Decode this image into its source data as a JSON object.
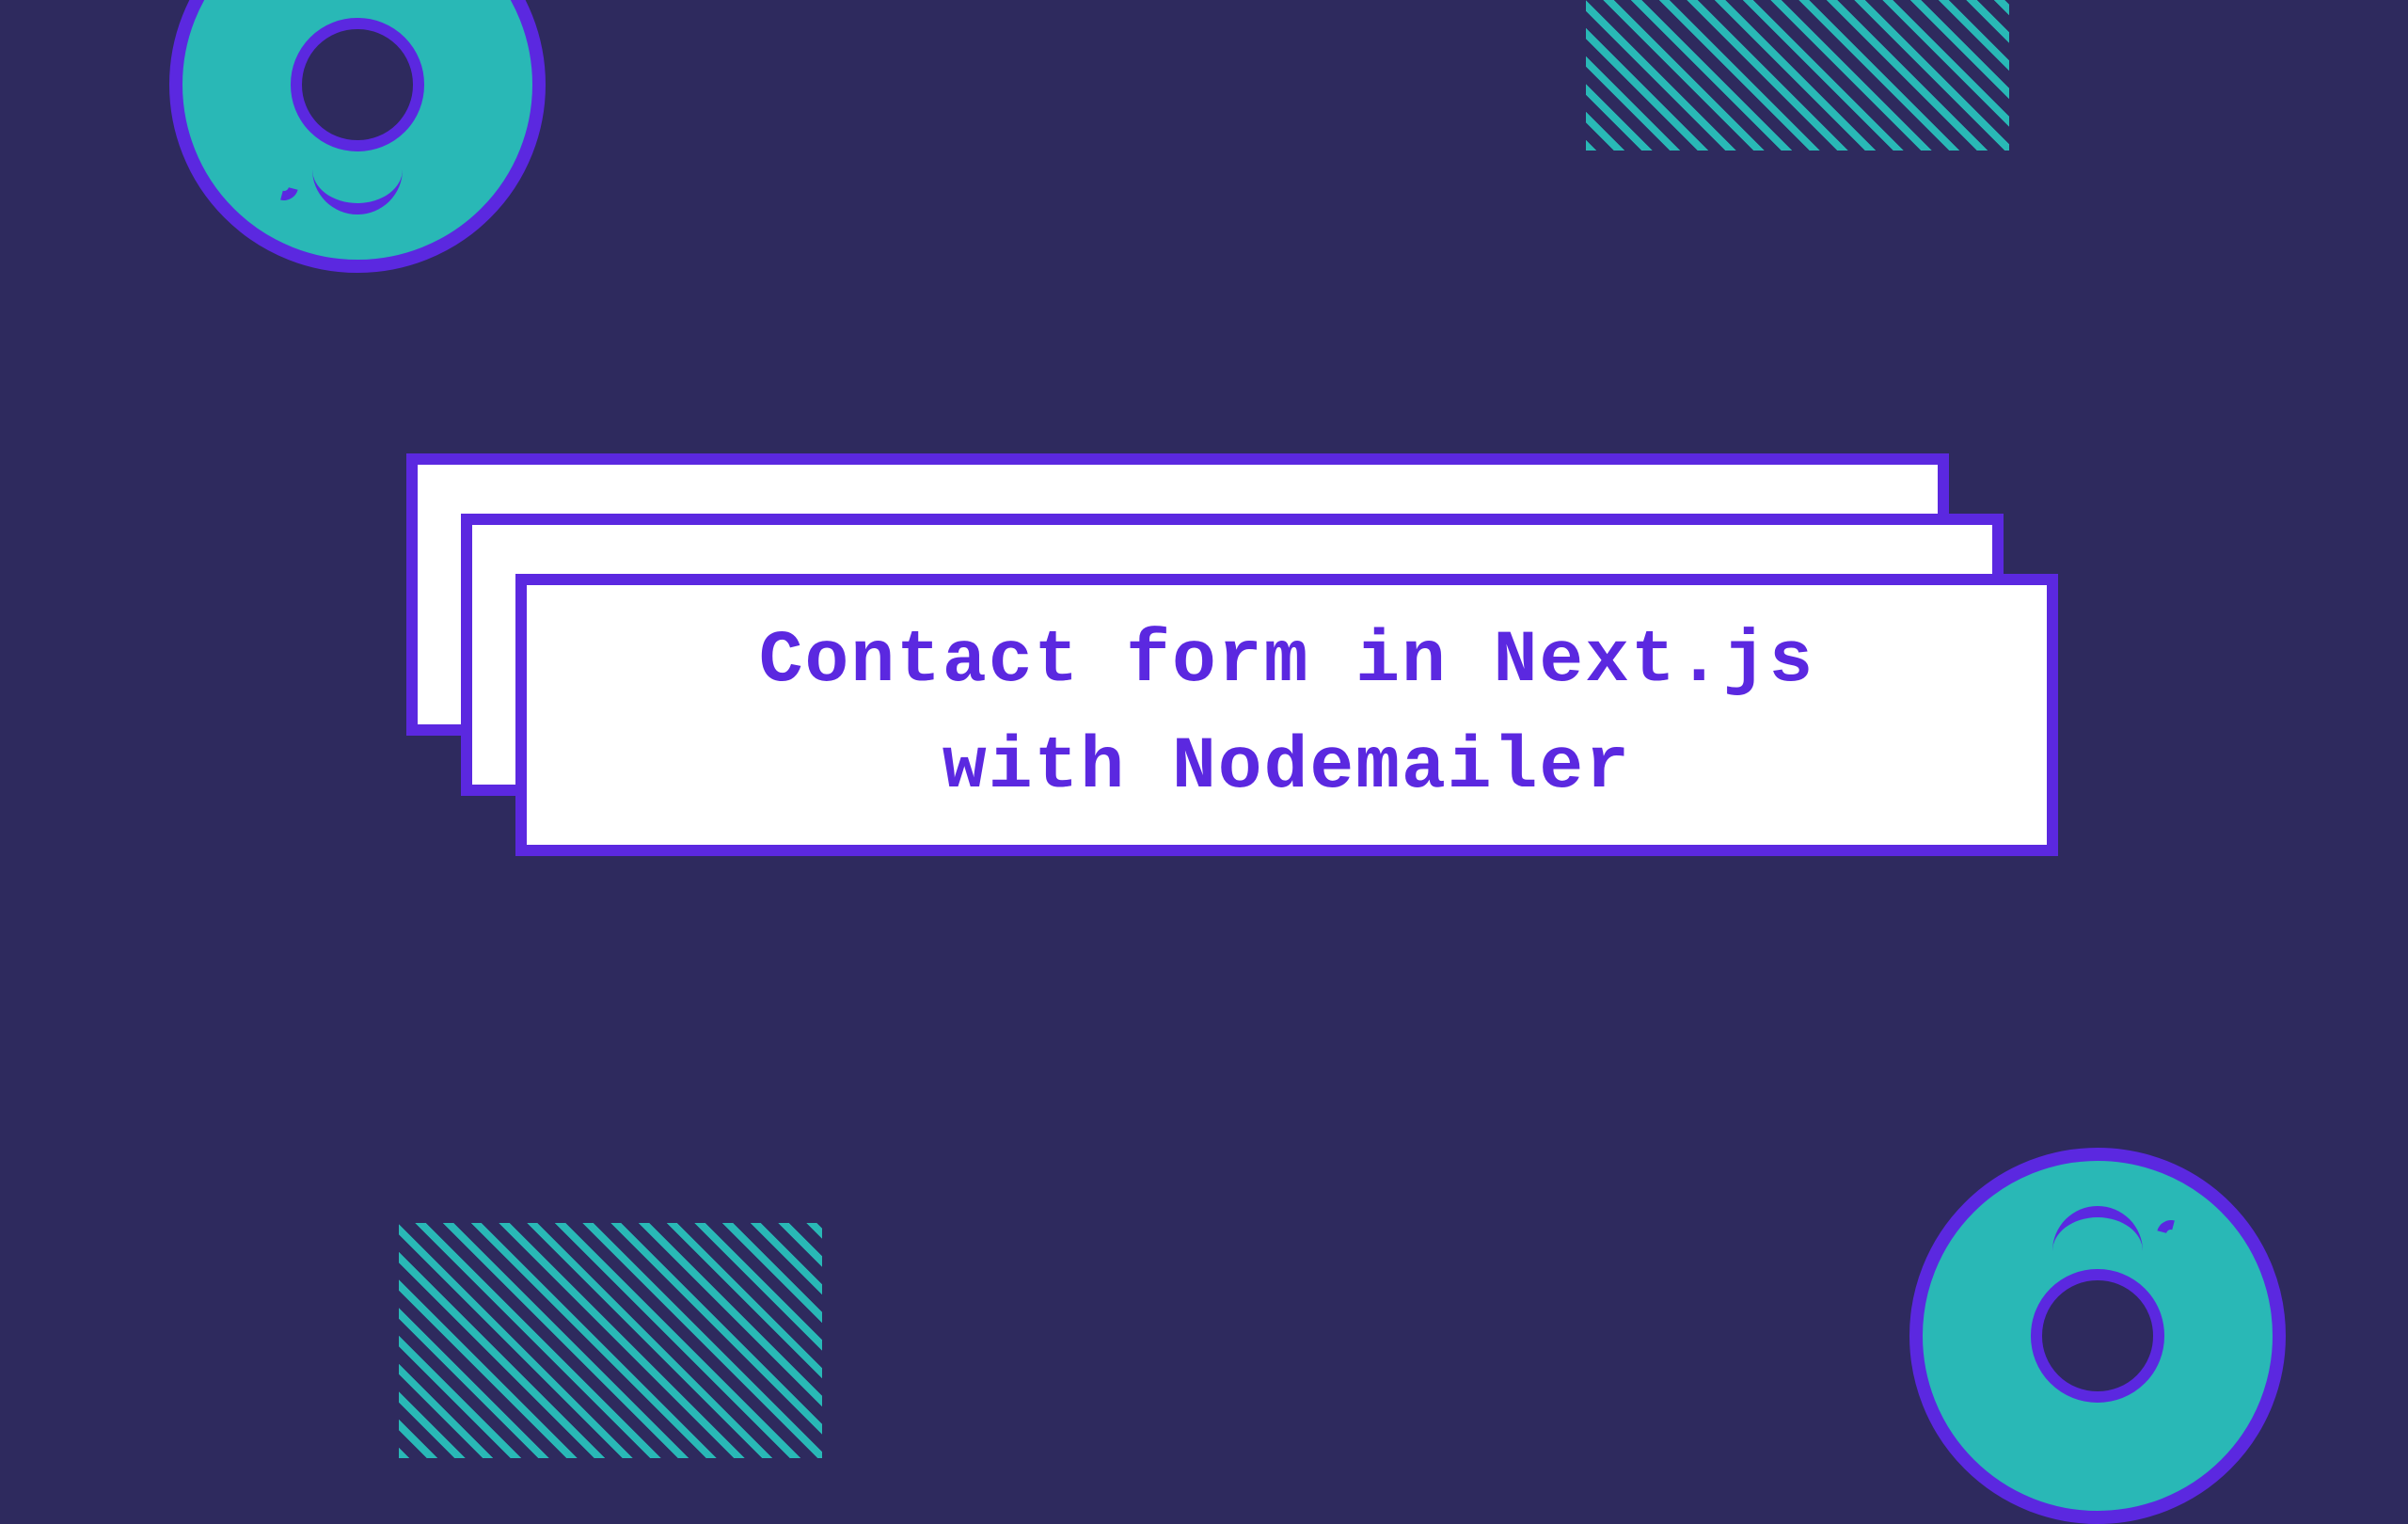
{
  "title": {
    "line1": "Contact form in Next.js",
    "line2": "with Nodemailer"
  },
  "colors": {
    "background": "#2E2A5E",
    "accent": "#29B8B6",
    "primary": "#5B28E0",
    "card": "#FFFFFF"
  }
}
